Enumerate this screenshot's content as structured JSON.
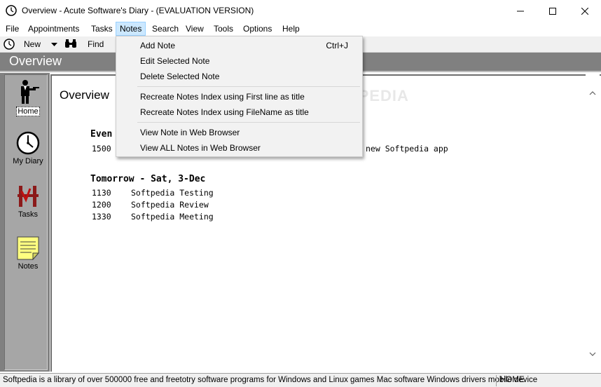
{
  "window": {
    "title": "Overview - Acute Software's Diary - (EVALUATION VERSION)",
    "controls": {
      "minimize": "—",
      "maximize": "☐",
      "close": "✕"
    }
  },
  "menubar": {
    "items": [
      {
        "label": "File"
      },
      {
        "label": "Appointments"
      },
      {
        "label": "Tasks"
      },
      {
        "label": "Notes",
        "active": true
      },
      {
        "label": "Search"
      },
      {
        "label": "View"
      },
      {
        "label": "Tools"
      },
      {
        "label": "Options"
      },
      {
        "label": "Help"
      }
    ]
  },
  "toolbar": {
    "new_label": "New",
    "find_label": "Find",
    "icons": {
      "new": "clock-icon",
      "dropdown": "triangle-down-icon",
      "find": "binoculars-icon"
    }
  },
  "heading": {
    "title": "Overview"
  },
  "sidebar": {
    "items": [
      {
        "label": "Home",
        "icon": "butler-icon",
        "selected": true
      },
      {
        "label": "My Diary",
        "icon": "clock-icon"
      },
      {
        "label": "Tasks",
        "icon": "tasks-icon"
      },
      {
        "label": "Notes",
        "icon": "notepad-icon"
      }
    ]
  },
  "content": {
    "title": "Overview",
    "watermark": "SOFTPEDIA",
    "sections": [
      {
        "heading": "Even",
        "events": [
          {
            "time": "1500",
            "text": "new Softpedia app"
          }
        ]
      },
      {
        "heading": "Tomorrow - Sat, 3-Dec",
        "events": [
          {
            "time": "1130",
            "text": "Softpedia Testing"
          },
          {
            "time": "1200",
            "text": "Softpedia Review"
          },
          {
            "time": "1330",
            "text": "Softpedia Meeting"
          }
        ]
      }
    ]
  },
  "notes_menu": {
    "groups": [
      [
        {
          "label": "Add Note",
          "shortcut": "Ctrl+J"
        },
        {
          "label": "Edit Selected Note"
        },
        {
          "label": "Delete Selected Note"
        }
      ],
      [
        {
          "label": "Recreate Notes Index using First line as title"
        },
        {
          "label": "Recreate Notes Index using FileName as title"
        }
      ],
      [
        {
          "label": "View Note in Web Browser"
        },
        {
          "label": "View ALL Notes in Web Browser"
        }
      ]
    ]
  },
  "statusbar": {
    "message": "Softpedia is a library of over 500000 free and freetotry software programs for Windows and Linux games Mac software Windows drivers mobile device",
    "panel": "HOME"
  },
  "scrollbar": {
    "up": "⌃",
    "down": "⌄"
  }
}
